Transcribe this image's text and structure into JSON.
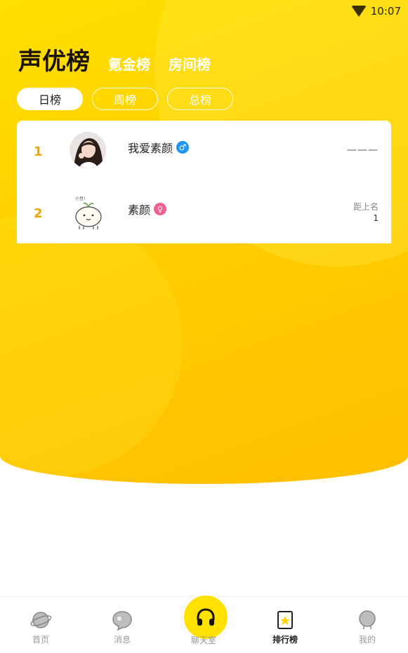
{
  "status": {
    "time": "10:07",
    "wifi_icon": "wifi-icon"
  },
  "header": {
    "title": "声优榜",
    "tabs": [
      "氪金榜",
      "房间榜"
    ]
  },
  "periods": {
    "items": [
      "日榜",
      "周榜",
      "总榜"
    ],
    "selected": "日榜"
  },
  "list": [
    {
      "rank": "1",
      "name": "我爱素颜",
      "gender_icon": "male-icon",
      "gap_label": "",
      "gap_value": "———"
    },
    {
      "rank": "2",
      "name": "素颜",
      "gender_icon": "female-icon",
      "gap_label": "距上名",
      "gap_value": "1"
    }
  ],
  "tabbar": {
    "items": [
      {
        "label": "首页",
        "icon": "planet-icon"
      },
      {
        "label": "消息",
        "icon": "message-bubble-icon"
      },
      {
        "label": "聊天室",
        "icon": "headphones-icon"
      },
      {
        "label": "排行榜",
        "icon": "ranking-star-icon"
      },
      {
        "label": "我的",
        "icon": "user-icon"
      }
    ],
    "active": "排行榜"
  },
  "colors": {
    "accent": "#ffd200",
    "rank": "#f0a50a",
    "male": "#2196f3",
    "female": "#f06292"
  }
}
